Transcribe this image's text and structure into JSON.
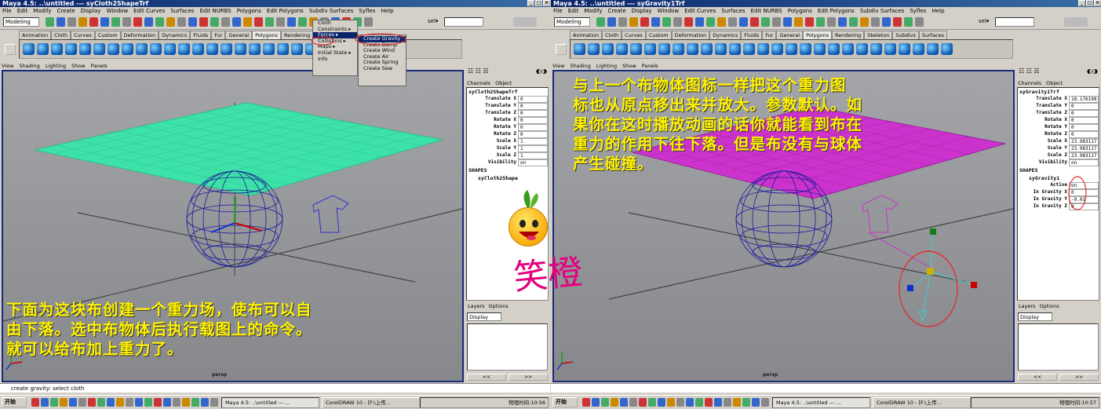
{
  "left": {
    "window_title": "Maya 4.5: ..\\untitled  ---  syCloth2ShapeTrf",
    "menu": [
      "File",
      "Edit",
      "Modify",
      "Create",
      "Display",
      "Window",
      "Edit Curves",
      "Surfaces",
      "Edit NURBS",
      "Polygons",
      "Edit Polygons",
      "Subdiv Surfaces",
      "Syflex",
      "Help"
    ],
    "mode": "Modeling",
    "sel_label": "sel▾",
    "shelf_tabs": [
      "Animation",
      "Cloth",
      "Curves",
      "Custom",
      "Deformation",
      "Dynamics",
      "Fluids",
      "Fur",
      "General",
      "Polygons",
      "Rendering",
      "Skeleton"
    ],
    "panel_menu": [
      "View",
      "Shading",
      "Lighting",
      "Show",
      "Panels"
    ],
    "viewport_label": "persp",
    "overlay": [
      "下面为这块布创建一个重力场，使布可以自",
      "由下落。选中布物体后执行载图上的命令。",
      "就可以给布加上重力了。"
    ],
    "channel_tabs": [
      "Channels",
      "Object"
    ],
    "object_name": "syCloth2ShapeTrf",
    "channels": [
      {
        "k": "Translate X",
        "v": "0"
      },
      {
        "k": "Translate Y",
        "v": "0"
      },
      {
        "k": "Translate Z",
        "v": "0"
      },
      {
        "k": "Rotate X",
        "v": "0"
      },
      {
        "k": "Rotate Y",
        "v": "0"
      },
      {
        "k": "Rotate Z",
        "v": "0"
      },
      {
        "k": "Scale X",
        "v": "1"
      },
      {
        "k": "Scale Y",
        "v": "1"
      },
      {
        "k": "Scale Z",
        "v": "1"
      },
      {
        "k": "Visibility",
        "v": "on"
      }
    ],
    "shapes_label": "SHAPES",
    "shape_name": "syCloth2Shape",
    "layers_menu": [
      "Layers",
      "Options"
    ],
    "layers_select": "Display",
    "cmd_line": "create gravity: select cloth",
    "syflex_menu": [
      "Cloth",
      "Constraints ▸",
      "Forces ▸",
      "Collisions ▸",
      "Maps ▸",
      "Initial State ▸",
      "Info"
    ],
    "forces_submenu": [
      "Create Gravity",
      "Create Damp",
      "Create Wind",
      "Create Air",
      "Create Spring",
      "Create Sew"
    ],
    "taskbar": {
      "start": "开始",
      "task1": "Maya 4.5: ..\\untitled  ---  ...",
      "task2": "CorelDRAW 10 - [F:\\上传...",
      "clock": "物理时间:10:56"
    }
  },
  "right": {
    "window_title": "Maya 4.5: ..\\untitled  ---  syGravity1Trf",
    "menu": [
      "File",
      "Edit",
      "Modify",
      "Create",
      "Display",
      "Window",
      "Edit Curves",
      "Surfaces",
      "Edit NURBS",
      "Polygons",
      "Edit Polygons",
      "Subdiv Surfaces",
      "Syflex",
      "Help"
    ],
    "mode": "Modeling",
    "sel_label": "sel▾",
    "shelf_tabs": [
      "Animation",
      "Cloth",
      "Curves",
      "Custom",
      "Deformation",
      "Dynamics",
      "Fluids",
      "Fur",
      "General",
      "Polygons",
      "Rendering",
      "Skeleton",
      "Subdivs",
      "Surfaces"
    ],
    "panel_menu": [
      "View",
      "Shading",
      "Lighting",
      "Show",
      "Panels"
    ],
    "viewport_label": "persp",
    "overlay": [
      "与上一个布物体图标一样把这个重力图",
      "标也从原点移出来并放大。参数默认。如",
      "果你在这时播放动画的话你就能看到布在",
      "重力的作用下往下落。但是布没有与球体",
      "产生碰撞。"
    ],
    "channel_tabs": [
      "Channels",
      "Object"
    ],
    "object_name": "syGravity1Trf",
    "channels": [
      {
        "k": "Translate X",
        "v": "18.176198"
      },
      {
        "k": "Translate Y",
        "v": "0"
      },
      {
        "k": "Translate Z",
        "v": "0"
      },
      {
        "k": "Rotate X",
        "v": "0"
      },
      {
        "k": "Rotate Y",
        "v": "0"
      },
      {
        "k": "Rotate Z",
        "v": "0"
      },
      {
        "k": "Scale X",
        "v": "23.983117"
      },
      {
        "k": "Scale Y",
        "v": "23.983117"
      },
      {
        "k": "Scale Z",
        "v": "23.983117"
      },
      {
        "k": "Visibility",
        "v": "on"
      }
    ],
    "shapes_label": "SHAPES",
    "shape_name": "syGravity1",
    "shape_channels": [
      {
        "k": "Active",
        "v": "on"
      },
      {
        "k": "In Gravity X",
        "v": "0"
      },
      {
        "k": "In Gravity Y",
        "v": "-0.01"
      },
      {
        "k": "In Gravity Z",
        "v": "0"
      }
    ],
    "layers_menu": [
      "Layers",
      "Options"
    ],
    "layers_select": "Display",
    "cmd_line": "",
    "taskbar": {
      "start": "开始",
      "task1": "Maya 4.5: ..\\untitled  ---  ...",
      "task2": "CorelDRAW 10 - [F:\\上传...",
      "clock": "物理时间:10:57"
    }
  },
  "watermark": "笑橙",
  "colors": {
    "cloth_green": "#3de2a8",
    "cloth_magenta": "#cc33cc",
    "sphere_blue": "#1a1a9a",
    "overlay_yellow": "#fff200",
    "title_blue": "#0a246a",
    "highlight_red": "#e03030"
  }
}
